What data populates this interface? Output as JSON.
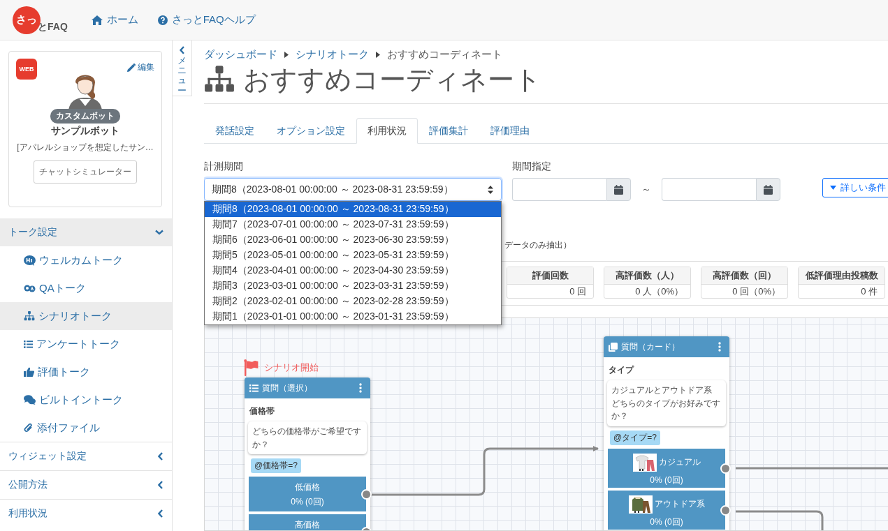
{
  "header": {
    "logo": {
      "mark": "さっ",
      "text": "とFAQ"
    },
    "nav": [
      {
        "label": "ホーム"
      },
      {
        "label": "さっとFAQヘルプ"
      }
    ]
  },
  "bot": {
    "badge": "WEB",
    "edit": "編集",
    "tag": "カスタムボット",
    "name": "サンプルボット",
    "description": "[アパレルショップを想定したサン…",
    "button": "チャットシミュレーター"
  },
  "sidebar": {
    "groups": [
      {
        "label": "トーク設定",
        "expanded": true,
        "children": [
          {
            "label": "ウェルカムトーク",
            "selected": false
          },
          {
            "label": "QAトーク",
            "selected": false
          },
          {
            "label": "シナリオトーク",
            "selected": true
          },
          {
            "label": "アンケートトーク",
            "selected": false
          },
          {
            "label": "評価トーク",
            "selected": false
          },
          {
            "label": "ビルトイントーク",
            "selected": false
          },
          {
            "label": "添付ファイル",
            "selected": false
          }
        ]
      },
      {
        "label": "ウィジェット設定",
        "expanded": false
      },
      {
        "label": "公開方法",
        "expanded": false
      },
      {
        "label": "利用状況",
        "expanded": false
      }
    ]
  },
  "menu_toggle": {
    "label": "メニュー"
  },
  "breadcrumb": [
    "ダッシュボード",
    "シナリオトーク",
    "おすすめコーディネート"
  ],
  "title": "おすすめコーディネート",
  "tabs": [
    {
      "label": "発話設定",
      "selected": false
    },
    {
      "label": "オプション設定",
      "selected": false
    },
    {
      "label": "利用状況",
      "selected": true
    },
    {
      "label": "評価集計",
      "selected": false
    },
    {
      "label": "評価理由",
      "selected": false
    }
  ],
  "filter": {
    "period_label": "計測期間",
    "period_value": "期間8（2023-08-01 00:00:00 ～ 2023-08-31 23:59:59）",
    "options": [
      {
        "label": "期間8（2023-08-01 00:00:00 ～ 2023-08-31 23:59:59）",
        "selected": true
      },
      {
        "label": "期間7（2023-07-01 00:00:00 ～ 2023-07-31 23:59:59）",
        "selected": false
      },
      {
        "label": "期間6（2023-06-01 00:00:00 ～ 2023-06-30 23:59:59）",
        "selected": false
      },
      {
        "label": "期間5（2023-05-01 00:00:00 ～ 2023-05-31 23:59:59）",
        "selected": false
      },
      {
        "label": "期間4（2023-04-01 00:00:00 ～ 2023-04-30 23:59:59）",
        "selected": false
      },
      {
        "label": "期間3（2023-03-01 00:00:00 ～ 2023-03-31 23:59:59）",
        "selected": false
      },
      {
        "label": "期間2（2023-02-01 00:00:00 ～ 2023-02-28 23:59:59）",
        "selected": false
      },
      {
        "label": "期間1（2023-01-01 00:00:00 ～ 2023-01-31 23:59:59）",
        "selected": false
      }
    ],
    "range_label": "期間指定",
    "range_separator": "～",
    "more_button": "詳しい条件"
  },
  "note": "データのみ抽出）",
  "stats": [
    {
      "label": "評価回数",
      "value": "0 回"
    },
    {
      "label": "高評価数（人）",
      "value": "0 人（0%）"
    },
    {
      "label": "高評価数（回）",
      "value": "0 回（0%）"
    },
    {
      "label": "低評価理由投稿数",
      "value": "0 件"
    }
  ],
  "flow": {
    "start_label": "シナリオ開始",
    "nodes": [
      {
        "kind": "select",
        "header": "質問（選択）",
        "title": "価格帯",
        "message": [
          "どちらの価格帯がご希望ですか？"
        ],
        "variable": "@価格帯=?",
        "options": [
          {
            "label": "低価格",
            "rate": "0% (0回)"
          },
          {
            "label": "高価格"
          }
        ]
      },
      {
        "kind": "card",
        "header": "質問（カード）",
        "title": "タイプ",
        "message": [
          "カジュアルとアウトドア系",
          "どちらのタイプがお好みですか？"
        ],
        "variable": "@タイプ=?",
        "options": [
          {
            "label": "カジュアル",
            "rate": "0% (0回)"
          },
          {
            "label": "アウトドア系",
            "rate": "0% (0回)"
          }
        ]
      }
    ]
  }
}
